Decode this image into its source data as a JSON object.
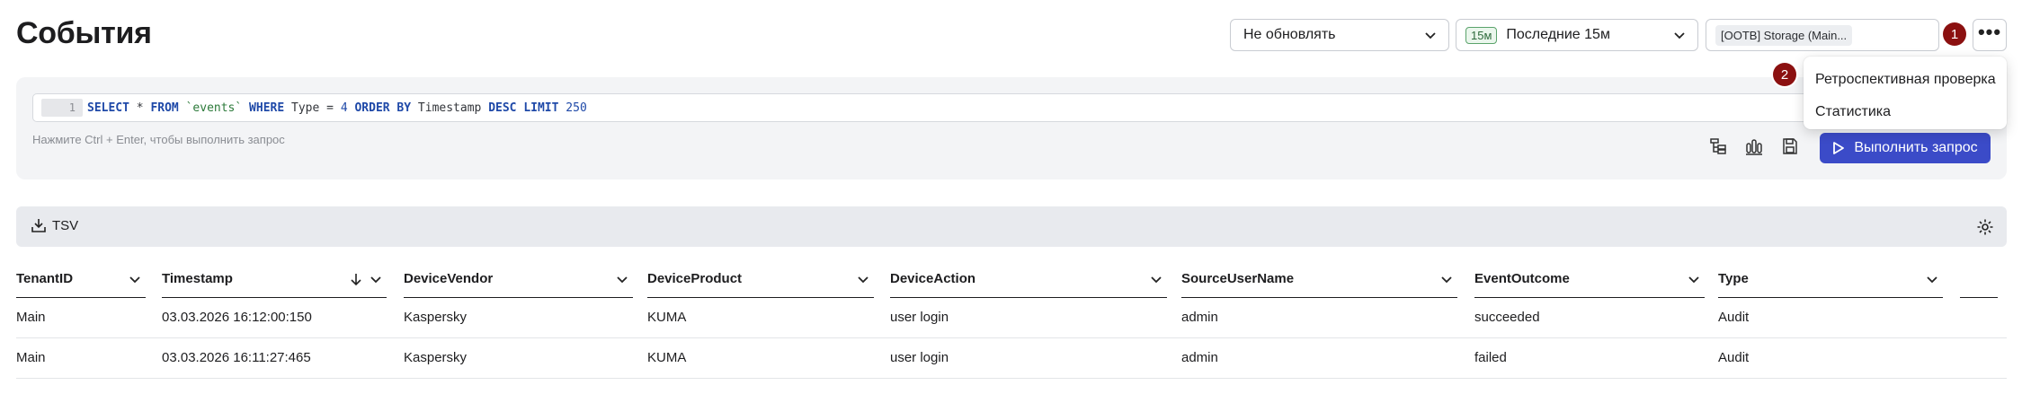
{
  "header": {
    "title": "События",
    "refresh_select": "Не обновлять",
    "period_badge": "15м",
    "period_select": "Последние 15м",
    "storage_chip": "[OOTB] Storage (Main...",
    "more_label": "•••",
    "step_1": "1",
    "step_2": "2"
  },
  "query": {
    "line_number": "1",
    "code": {
      "kw_select": "SELECT",
      "star": " * ",
      "kw_from": "FROM",
      "table": " `events` ",
      "kw_where": "WHERE",
      "field_type": " Type ",
      "eq": "= ",
      "num_4": "4",
      "kw_order": " ORDER BY",
      "field_ts": " Timestamp ",
      "kw_desc": "DESC",
      "kw_limit": " LIMIT",
      "num_250": " 250"
    },
    "hint": "Нажмите Ctrl + Enter, чтобы выполнить запрос",
    "run_label": "Выполнить запрос"
  },
  "menu": {
    "items": [
      "Ретроспективная проверка",
      "Статистика"
    ]
  },
  "results": {
    "tsv_label": "TSV",
    "columns": [
      "TenantID",
      "Timestamp",
      "DeviceVendor",
      "DeviceProduct",
      "DeviceAction",
      "SourceUserName",
      "EventOutcome",
      "Type"
    ],
    "rows": [
      [
        "Main",
        "03.03.2026 16:12:00:150",
        "Kaspersky",
        "KUMA",
        "user login",
        "admin",
        "succeeded",
        "Audit"
      ],
      [
        "Main",
        "03.03.2026 16:11:27:465",
        "Kaspersky",
        "KUMA",
        "user login",
        "admin",
        "failed",
        "Audit"
      ]
    ]
  },
  "colors": {
    "accent": "#3b4bc8",
    "step_badge": "#8b1010",
    "panel_bg": "#f3f4f6"
  }
}
